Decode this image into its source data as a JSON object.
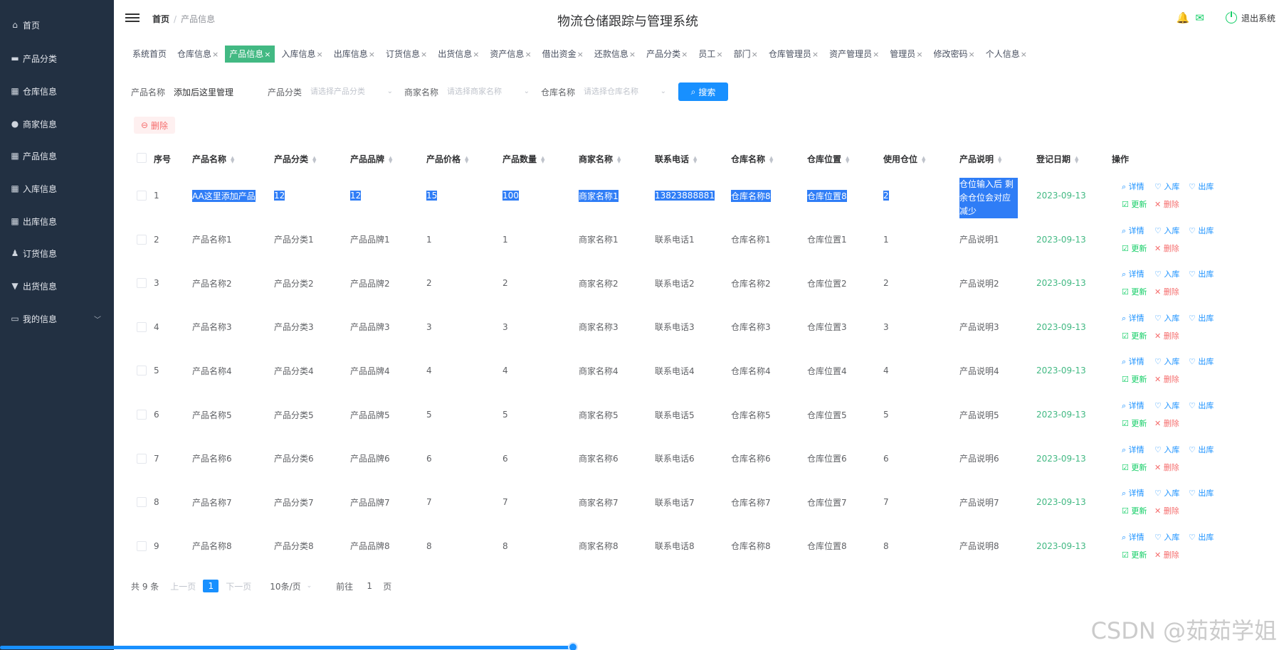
{
  "sidebar": {
    "items": [
      {
        "label": "首页",
        "icon": "home-icon"
      },
      {
        "label": "产品分类",
        "icon": "box-icon"
      },
      {
        "label": "仓库信息",
        "icon": "grid-icon"
      },
      {
        "label": "商家信息",
        "icon": "location-icon"
      },
      {
        "label": "产品信息",
        "icon": "grid-icon"
      },
      {
        "label": "入库信息",
        "icon": "grid-icon"
      },
      {
        "label": "出库信息",
        "icon": "grid-icon"
      },
      {
        "label": "订货信息",
        "icon": "user-icon"
      },
      {
        "label": "出货信息",
        "icon": "tag-icon"
      },
      {
        "label": "我的信息",
        "icon": "card-icon"
      }
    ]
  },
  "header": {
    "breadcrumb_home": "首页",
    "breadcrumb_sep": "/",
    "breadcrumb_current": "产品信息",
    "title": "物流仓储跟踪与管理系统",
    "logout": "退出系统"
  },
  "tabs": [
    {
      "label": "系统首页",
      "closable": false
    },
    {
      "label": "仓库信息",
      "closable": true
    },
    {
      "label": "产品信息",
      "closable": true,
      "active": true
    },
    {
      "label": "入库信息",
      "closable": true
    },
    {
      "label": "出库信息",
      "closable": true
    },
    {
      "label": "订货信息",
      "closable": true
    },
    {
      "label": "出货信息",
      "closable": true
    },
    {
      "label": "资产信息",
      "closable": true
    },
    {
      "label": "借出资金",
      "closable": true
    },
    {
      "label": "还款信息",
      "closable": true
    },
    {
      "label": "产品分类",
      "closable": true
    },
    {
      "label": "员工",
      "closable": true
    },
    {
      "label": "部门",
      "closable": true
    },
    {
      "label": "仓库管理员",
      "closable": true
    },
    {
      "label": "资产管理员",
      "closable": true
    },
    {
      "label": "管理员",
      "closable": true
    },
    {
      "label": "修改密码",
      "closable": true
    },
    {
      "label": "个人信息",
      "closable": true
    }
  ],
  "search": {
    "product_name_label": "产品名称",
    "product_name_value": "添加后这里管理",
    "category_label": "产品分类",
    "category_placeholder": "请选择产品分类",
    "merchant_label": "商家名称",
    "merchant_placeholder": "请选择商家名称",
    "warehouse_label": "仓库名称",
    "warehouse_placeholder": "请选择仓库名称",
    "search_button": "搜索",
    "delete_button": "删除"
  },
  "table": {
    "columns": [
      "序号",
      "产品名称",
      "产品分类",
      "产品品牌",
      "产品价格",
      "产品数量",
      "商家名称",
      "联系电话",
      "仓库名称",
      "仓库位置",
      "使用仓位",
      "产品说明",
      "登记日期",
      "操作"
    ],
    "rows": [
      [
        "1",
        "AA这里添加产品",
        "12",
        "12",
        "15",
        "100",
        "商家名称1",
        "13823888881",
        "仓库名称8",
        "仓库位置8",
        "2",
        "仓位输入后 剩余仓位会对应减少",
        "2023-09-13"
      ],
      [
        "2",
        "产品名称1",
        "产品分类1",
        "产品品牌1",
        "1",
        "1",
        "商家名称1",
        "联系电话1",
        "仓库名称1",
        "仓库位置1",
        "1",
        "产品说明1",
        "2023-09-13"
      ],
      [
        "3",
        "产品名称2",
        "产品分类2",
        "产品品牌2",
        "2",
        "2",
        "商家名称2",
        "联系电话2",
        "仓库名称2",
        "仓库位置2",
        "2",
        "产品说明2",
        "2023-09-13"
      ],
      [
        "4",
        "产品名称3",
        "产品分类3",
        "产品品牌3",
        "3",
        "3",
        "商家名称3",
        "联系电话3",
        "仓库名称3",
        "仓库位置3",
        "3",
        "产品说明3",
        "2023-09-13"
      ],
      [
        "5",
        "产品名称4",
        "产品分类4",
        "产品品牌4",
        "4",
        "4",
        "商家名称4",
        "联系电话4",
        "仓库名称4",
        "仓库位置4",
        "4",
        "产品说明4",
        "2023-09-13"
      ],
      [
        "6",
        "产品名称5",
        "产品分类5",
        "产品品牌5",
        "5",
        "5",
        "商家名称5",
        "联系电话5",
        "仓库名称5",
        "仓库位置5",
        "5",
        "产品说明5",
        "2023-09-13"
      ],
      [
        "7",
        "产品名称6",
        "产品分类6",
        "产品品牌6",
        "6",
        "6",
        "商家名称6",
        "联系电话6",
        "仓库名称6",
        "仓库位置6",
        "6",
        "产品说明6",
        "2023-09-13"
      ],
      [
        "8",
        "产品名称7",
        "产品分类7",
        "产品品牌7",
        "7",
        "7",
        "商家名称7",
        "联系电话7",
        "仓库名称7",
        "仓库位置7",
        "7",
        "产品说明7",
        "2023-09-13"
      ],
      [
        "9",
        "产品名称8",
        "产品分类8",
        "产品品牌8",
        "8",
        "8",
        "商家名称8",
        "联系电话8",
        "仓库名称8",
        "仓库位置8",
        "8",
        "产品说明8",
        "2023-09-13"
      ]
    ],
    "actions": {
      "detail": "详情",
      "in": "入库",
      "out": "出库",
      "update": "更新",
      "delete": "删除"
    }
  },
  "pagination": {
    "total": "共 9 条",
    "prev": "上一页",
    "current": "1",
    "next": "下一页",
    "page_size": "10条/页",
    "goto_prefix": "前往",
    "goto_value": "1",
    "goto_suffix": "页"
  },
  "watermark": "CSDN @茹茹学姐",
  "colors": {
    "sidebar": "#223042",
    "accent": "#42b983",
    "primary": "#1890ff",
    "danger": "#f56c6c"
  }
}
